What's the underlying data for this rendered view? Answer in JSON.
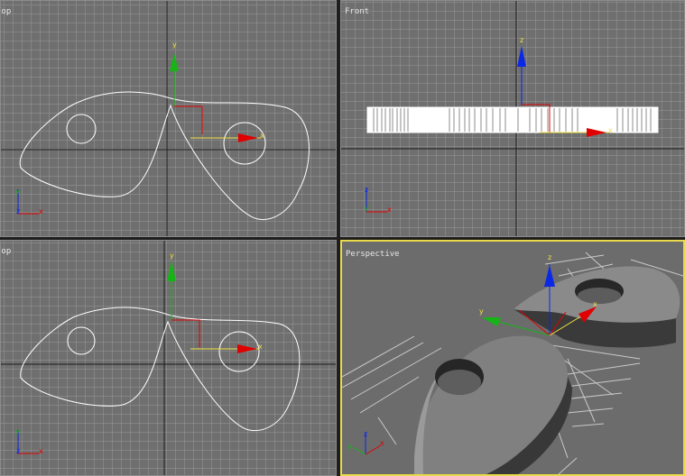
{
  "viewports": {
    "top": {
      "label": "Top"
    },
    "front": {
      "label": "Front"
    },
    "left": {
      "label": "Top"
    },
    "perspective": {
      "label": "Perspective",
      "active": true
    }
  },
  "axes": {
    "x": "x",
    "y": "y",
    "z": "z"
  },
  "colors": {
    "background": "#6f6f6f",
    "grid_minor": "#969696",
    "grid_major": "#1b1b1b",
    "spline": "#ffffff",
    "gizmo_x": "#e00000",
    "gizmo_y": "#16b416",
    "gizmo_z": "#0a28e6",
    "gizmo_selected": "#f0e040",
    "active_border": "#e9d94c"
  },
  "icons": [
    "move-gizmo",
    "axis-tripod-icon"
  ]
}
